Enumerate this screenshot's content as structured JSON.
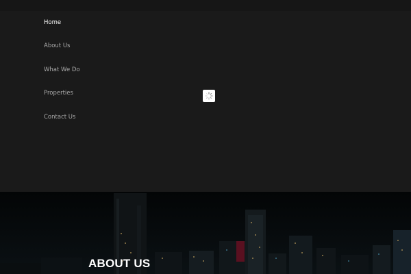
{
  "nav": {
    "items": [
      {
        "label": "Home",
        "active": true
      },
      {
        "label": "About Us",
        "active": false
      },
      {
        "label": "What We Do",
        "active": false
      },
      {
        "label": "Properties",
        "active": false
      },
      {
        "label": "Contact Us",
        "active": false
      }
    ]
  },
  "loader": {
    "icon": "spinner-icon"
  },
  "hero": {
    "title": "ABOUT US",
    "background": "night-city-skyline"
  },
  "colors": {
    "menu_bg": "#1a1a1a",
    "topbar_bg": "#161616",
    "nav_text": "#a8a8a8",
    "nav_active": "#ffffff",
    "hero_bg": "#05080a"
  }
}
